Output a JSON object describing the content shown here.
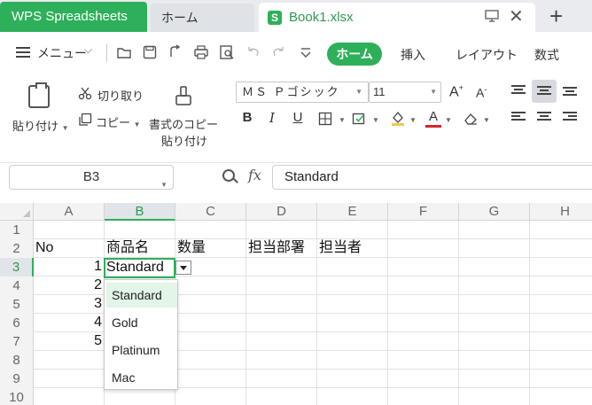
{
  "titlebar": {
    "app_tab": "WPS Spreadsheets",
    "home_tab": "ホーム",
    "file_tab": "Book1.xlsx",
    "file_icon_letter": "S",
    "new_tab": "+",
    "close": "✕"
  },
  "menubar": {
    "menu_label": "メニュー",
    "tabs": [
      "ホーム",
      "挿入",
      "レイアウト",
      "数式"
    ]
  },
  "ribbon": {
    "paste": "貼り付け",
    "cut": "切り取り",
    "copy": "コピー",
    "format_painter_line1": "書式のコピー",
    "format_painter_line2": "貼り付け",
    "font_name": "ＭＳ Ｐゴシック",
    "font_size": "11",
    "grow_font": "A",
    "shrink_font": "A",
    "bold": "B",
    "italic": "I",
    "underline": "U",
    "font_color_letter": "A",
    "colors": {
      "accent": "#2eb05a",
      "font_color_bar": "#d9232e",
      "fill_color_bar": "#f2c94c"
    }
  },
  "formula_bar": {
    "name_box": "B3",
    "fx": "fx",
    "content": "Standard"
  },
  "sheet": {
    "columns": [
      "A",
      "B",
      "C",
      "D",
      "E",
      "F",
      "G",
      "H"
    ],
    "rows": [
      "1",
      "2",
      "3",
      "4",
      "5",
      "6",
      "7",
      "8",
      "9",
      "10"
    ],
    "selected_column": "B",
    "selected_row": "3",
    "headers": {
      "A2": "No",
      "B2": "商品名",
      "C2": "数量",
      "D2": "担当部署",
      "E2": "担当者"
    },
    "numbers": [
      "1",
      "2",
      "3",
      "4",
      "5"
    ],
    "active_value": "Standard"
  },
  "dropdown": {
    "options": [
      "Standard",
      "Gold",
      "Platinum",
      "Mac"
    ],
    "highlighted": "Standard"
  }
}
